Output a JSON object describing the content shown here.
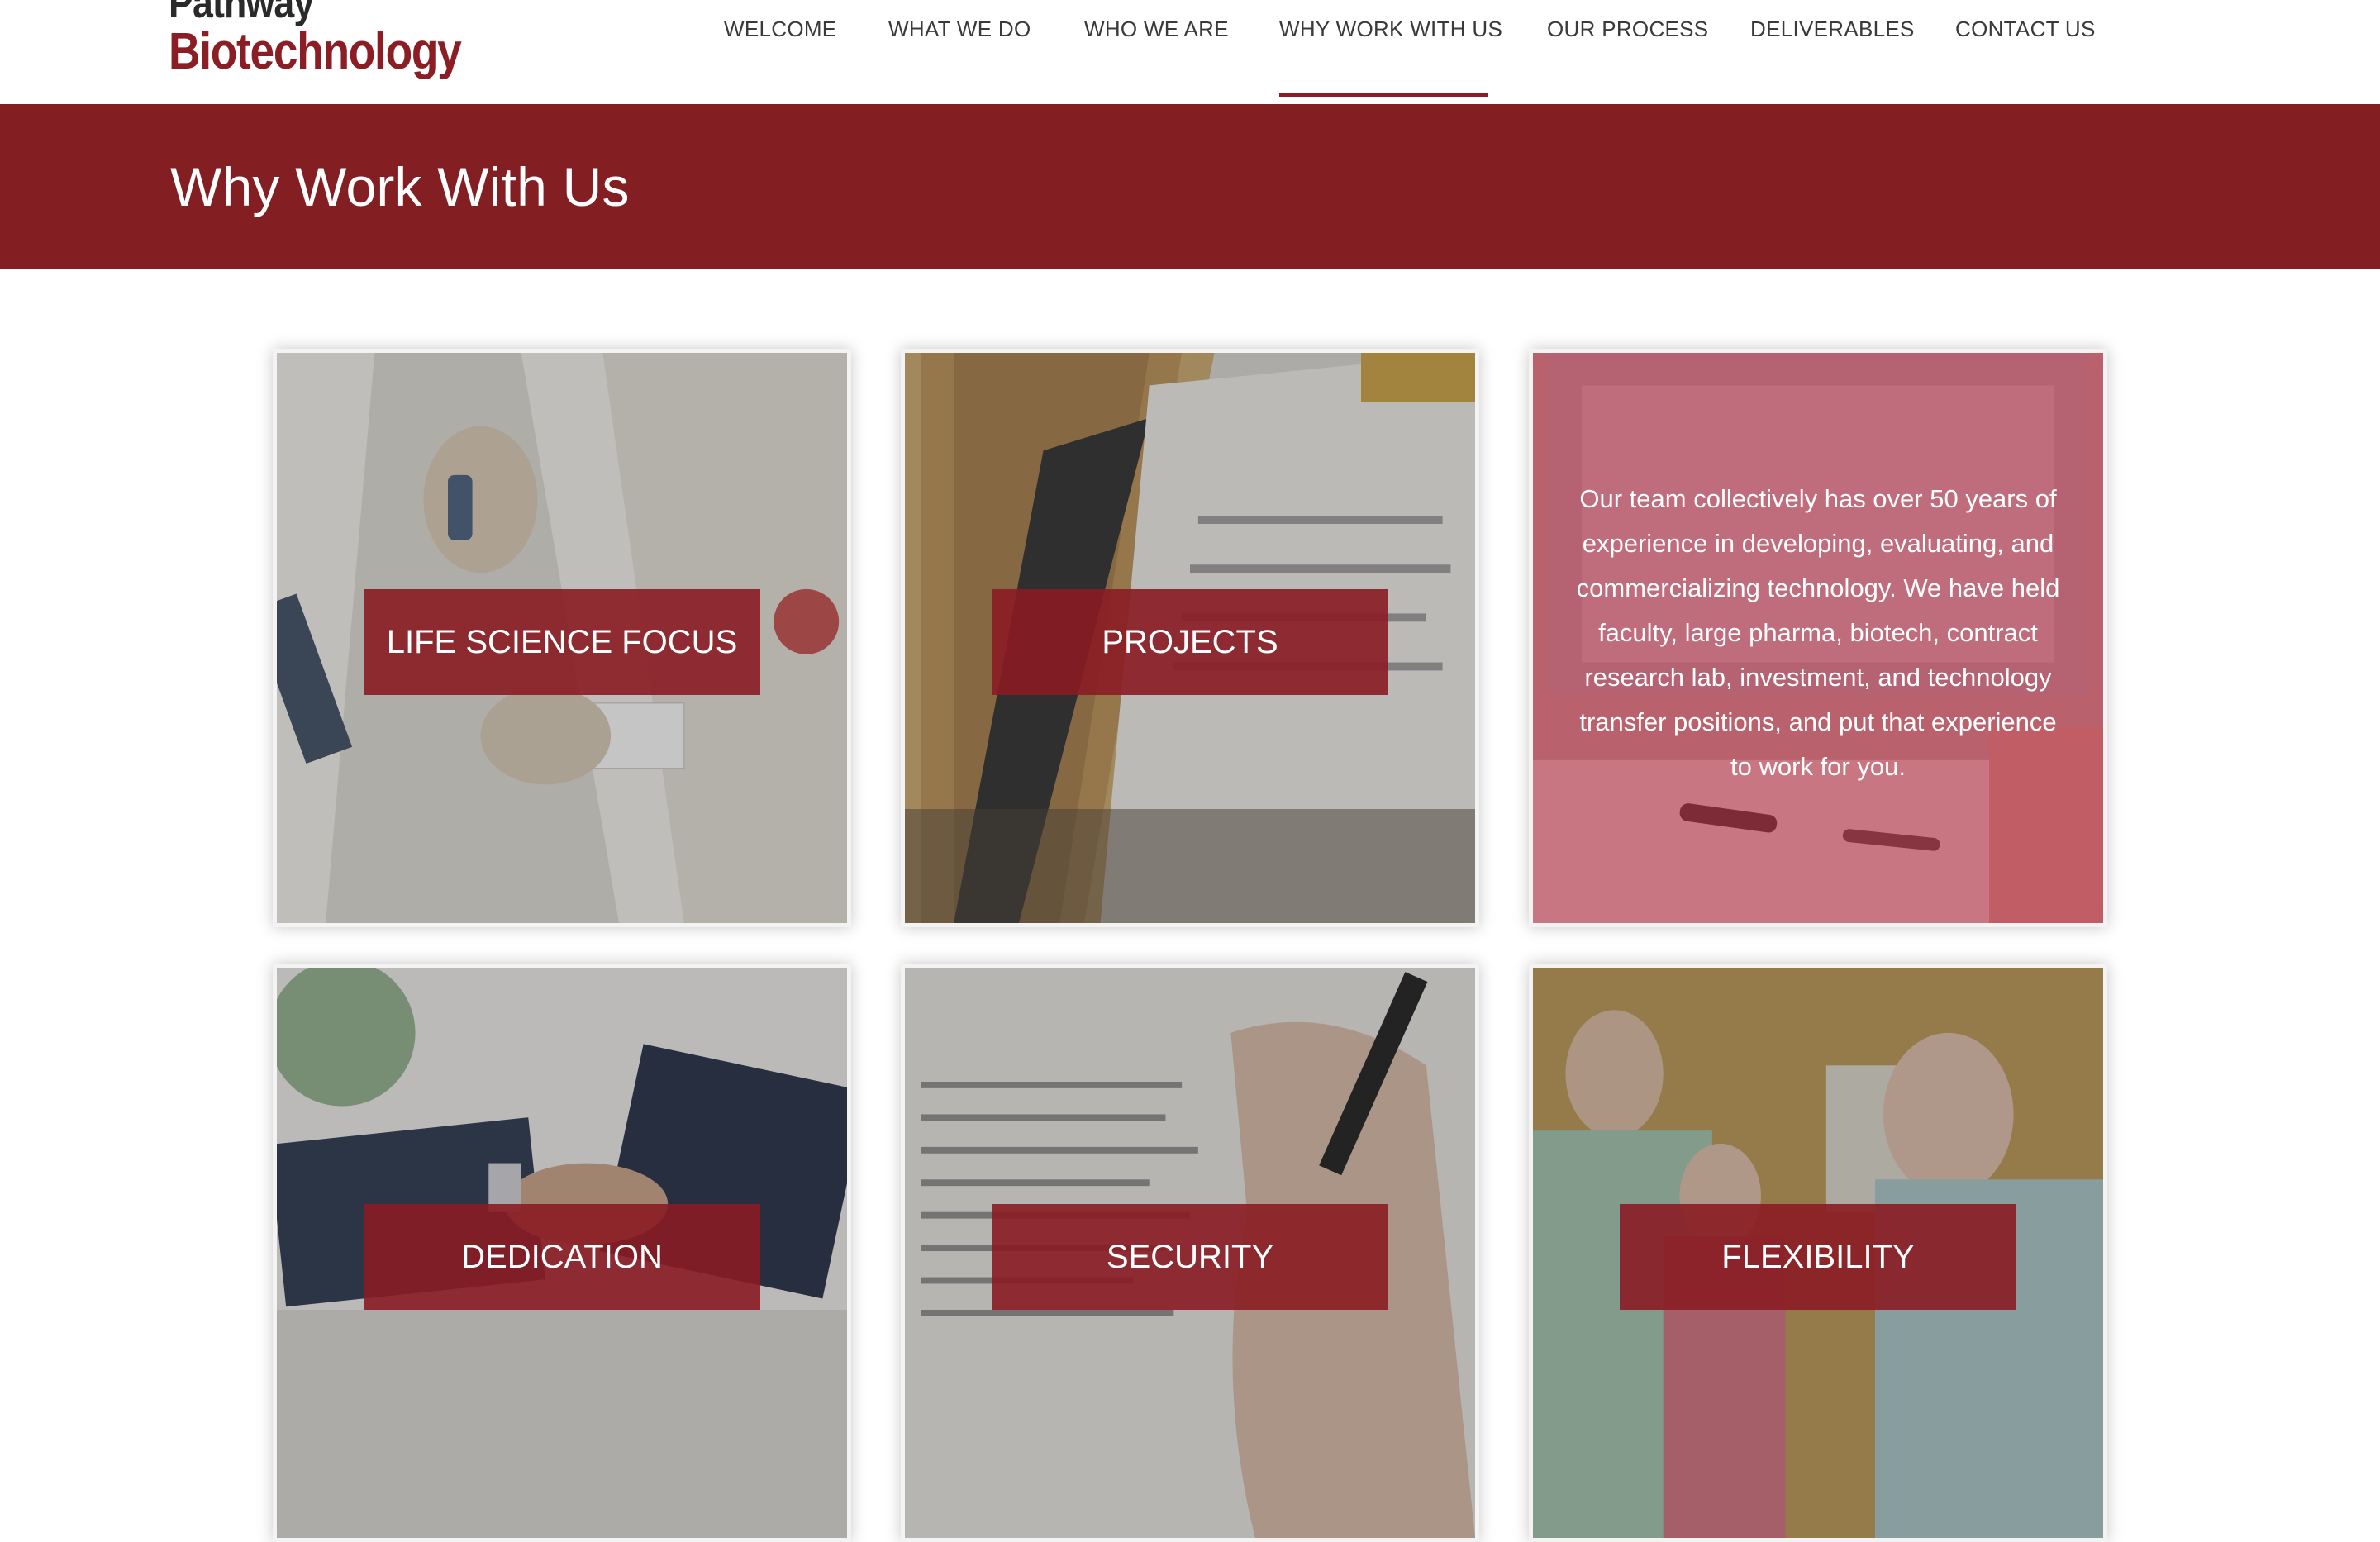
{
  "logo": {
    "line1": "Pathway",
    "line2": "Biotechnology"
  },
  "nav": {
    "items": [
      {
        "label": "WELCOME"
      },
      {
        "label": "WHAT WE DO"
      },
      {
        "label": "WHO WE ARE"
      },
      {
        "label": "WHY WORK WITH US",
        "active": true
      },
      {
        "label": "OUR PROCESS"
      },
      {
        "label": "DELIVERABLES"
      },
      {
        "label": "CONTACT US"
      }
    ]
  },
  "banner": {
    "title": "Why Work With Us"
  },
  "cards": [
    {
      "label": "LIFE SCIENCE FOCUS",
      "image": "scientist-lab-coat-photo"
    },
    {
      "label": "PROJECTS",
      "image": "file-folders-photo"
    },
    {
      "label": "",
      "image": "desk-documents-photo",
      "text": "Our team collectively has over 50 years of experience in developing, evaluating, and commercializing technology. We have held faculty, large pharma, biotech, contract research lab, investment, and technology transfer positions, and put that experience to work for you."
    },
    {
      "label": "DEDICATION",
      "image": "handshake-photo"
    },
    {
      "label": "SECURITY",
      "image": "signing-document-photo"
    },
    {
      "label": "FLEXIBILITY",
      "image": "team-portrait-photo"
    }
  ],
  "colors": {
    "brand": "#831e22",
    "label_bg": "#8a1c24",
    "hover_overlay": "#b22c40",
    "nav_text": "#3a3a3a"
  }
}
